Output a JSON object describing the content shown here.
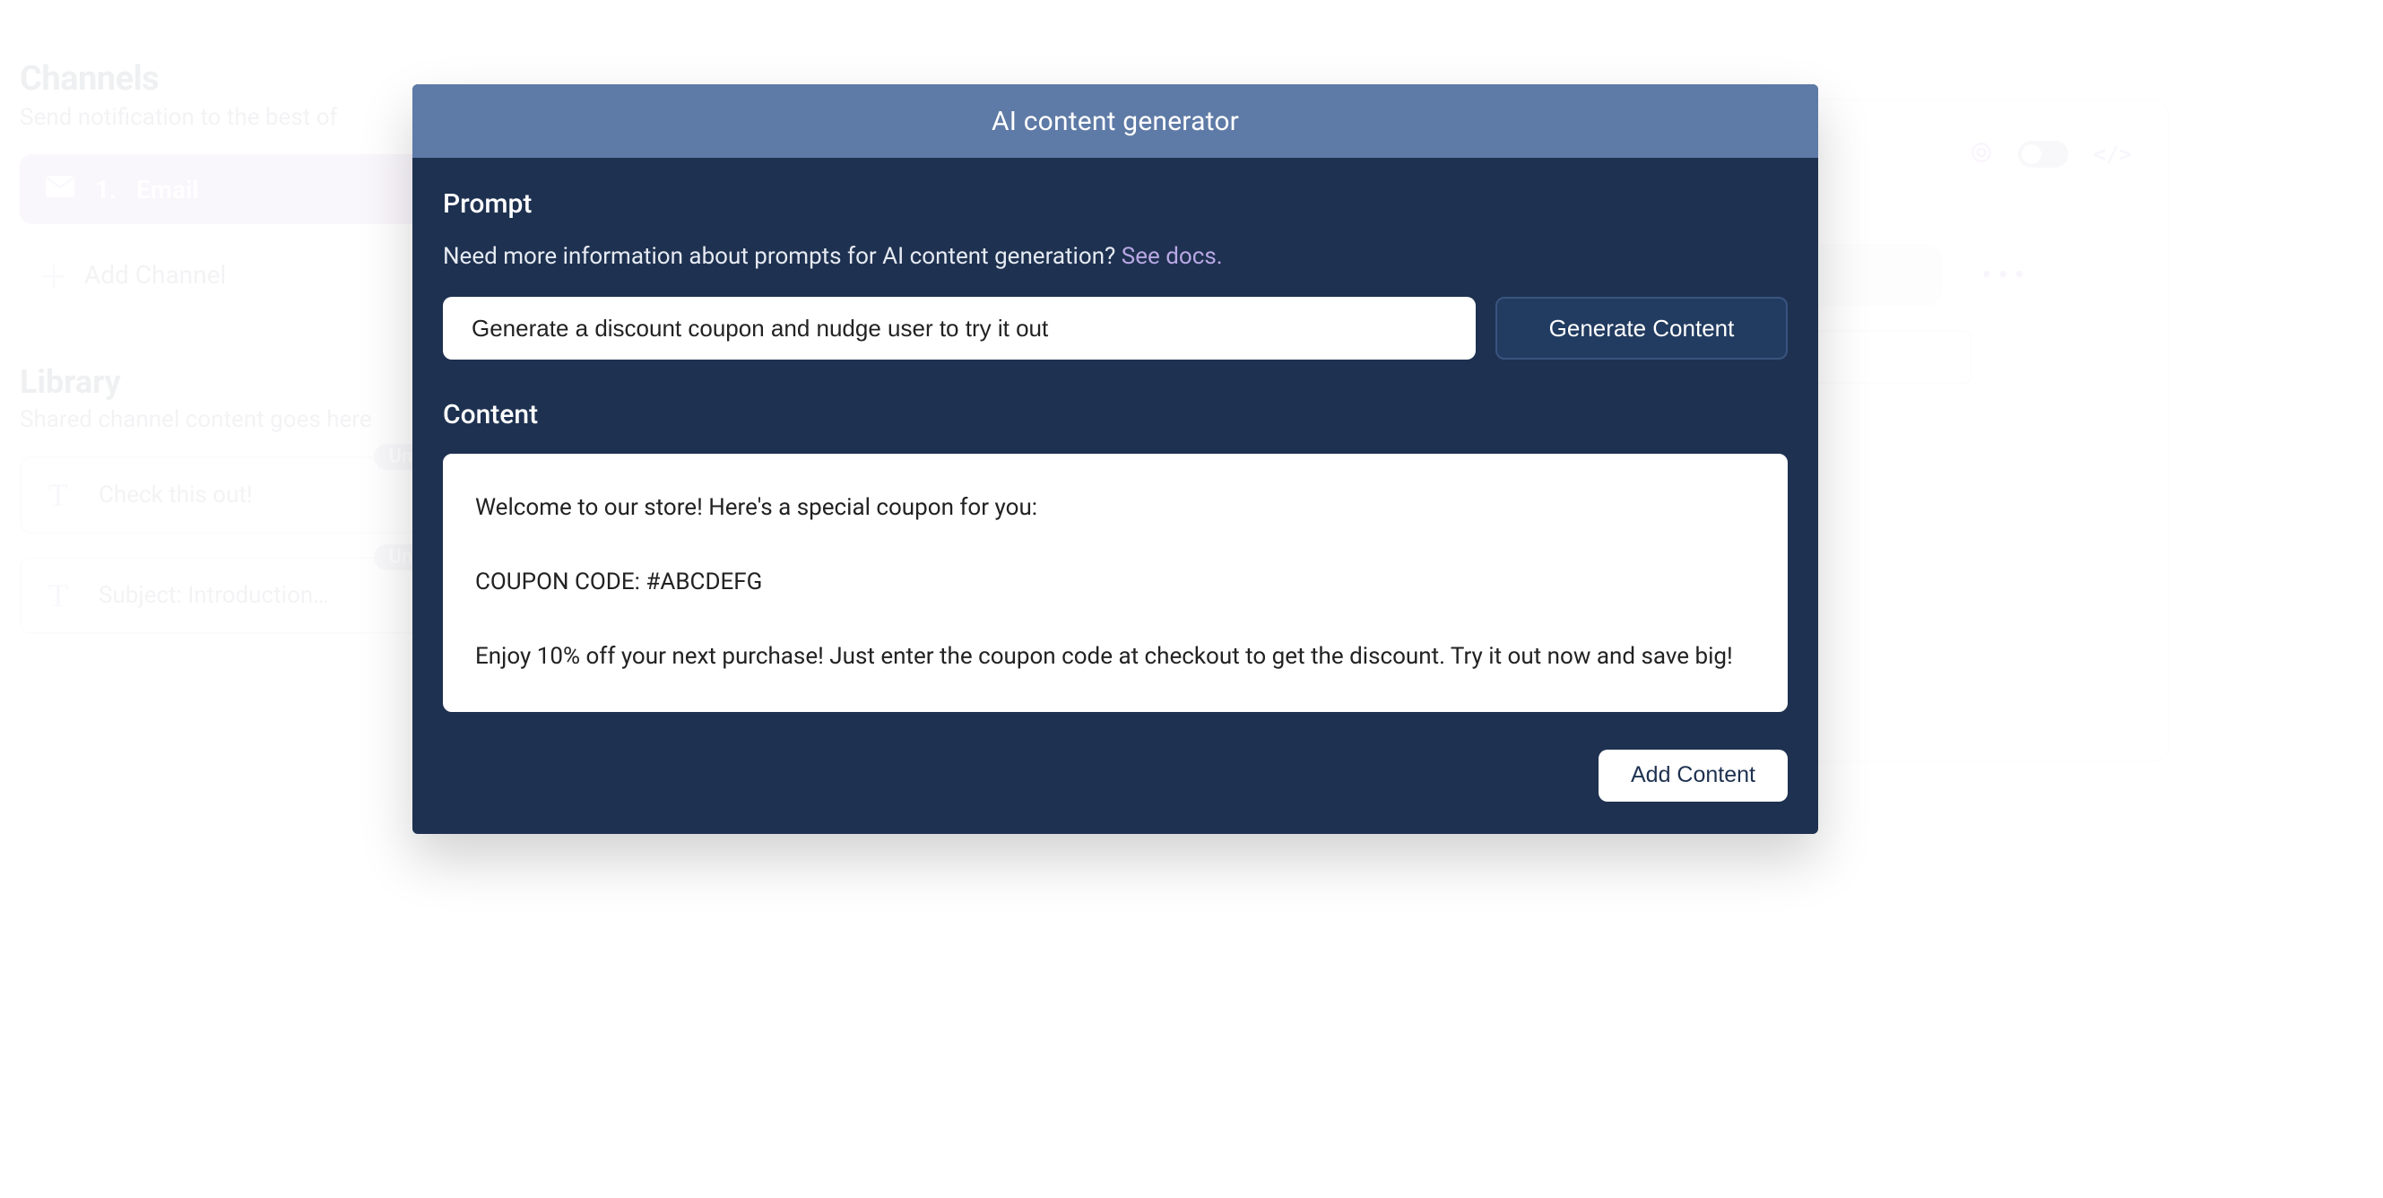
{
  "sidebar": {
    "channels_title": "Channels",
    "channels_subtitle": "Send notification to the best of",
    "channel_item": {
      "index_label": "1.",
      "name": "Email"
    },
    "add_channel_label": "Add Channel",
    "library_title": "Library",
    "library_subtitle": "Shared channel content goes here",
    "items": [
      {
        "text": "Check this out!",
        "badge": "Unused"
      },
      {
        "text": "Subject: Introduction…",
        "badge": "Unused"
      }
    ]
  },
  "editor": {
    "code_glyph": "</>"
  },
  "modal": {
    "title": "AI content generator",
    "prompt_label": "Prompt",
    "help_text": "Need more information about prompts for AI content generation? ",
    "help_link": "See docs.",
    "prompt_value": "Generate a discount coupon and nudge user to try it out",
    "generate_label": "Generate Content",
    "content_label": "Content",
    "content_text": "Welcome to our store! Here's a special coupon for you:\n\nCOUPON CODE: #ABCDEFG\n\nEnjoy 10% off your next purchase! Just enter the coupon code at checkout to get the discount. Try it out now and save big!",
    "add_content_label": "Add Content"
  }
}
